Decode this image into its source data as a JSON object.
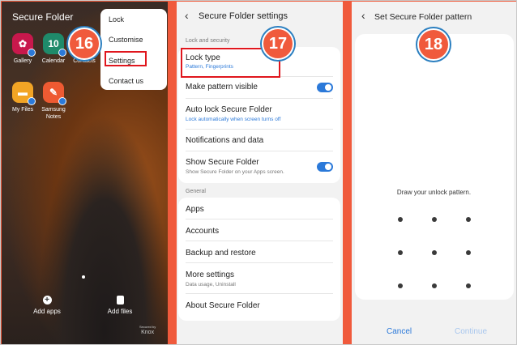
{
  "panel1": {
    "title": "Secure Folder",
    "apps": [
      "Gallery",
      "Calendar",
      "Contacts",
      "My Files",
      "Samsung Notes"
    ],
    "calendar_day": "10",
    "menu": [
      "Lock",
      "Customise",
      "Settings",
      "Contact us"
    ],
    "step": "16",
    "bottom": [
      "Add apps",
      "Add files"
    ],
    "knox_small": "Secured by",
    "knox": "Knox"
  },
  "panel2": {
    "header": "Secure Folder settings",
    "section_lock": "Lock and security",
    "lock_type": "Lock type",
    "lock_type_sub": "Pattern, Fingerprints",
    "pattern_visible": "Make pattern visible",
    "auto_lock": "Auto lock Secure Folder",
    "auto_lock_sub": "Lock automatically when screen turns off",
    "notifications": "Notifications and data",
    "show_folder": "Show Secure Folder",
    "show_folder_sub": "Show Secure Folder on your Apps screen.",
    "section_general": "General",
    "general_items": [
      "Apps",
      "Accounts",
      "Backup and restore",
      "More settings",
      "About Secure Folder"
    ],
    "more_settings_sub": "Data usage, Uninstall",
    "step": "17"
  },
  "panel3": {
    "header": "Set Secure Folder pattern",
    "instruction": "Draw your unlock pattern.",
    "cancel": "Cancel",
    "continue": "Continue",
    "step": "18"
  },
  "colors": {
    "accent": "#2b79d9",
    "highlight": "#e0161d",
    "step_badge": "#f05a3c",
    "background": "#f05a3c"
  }
}
